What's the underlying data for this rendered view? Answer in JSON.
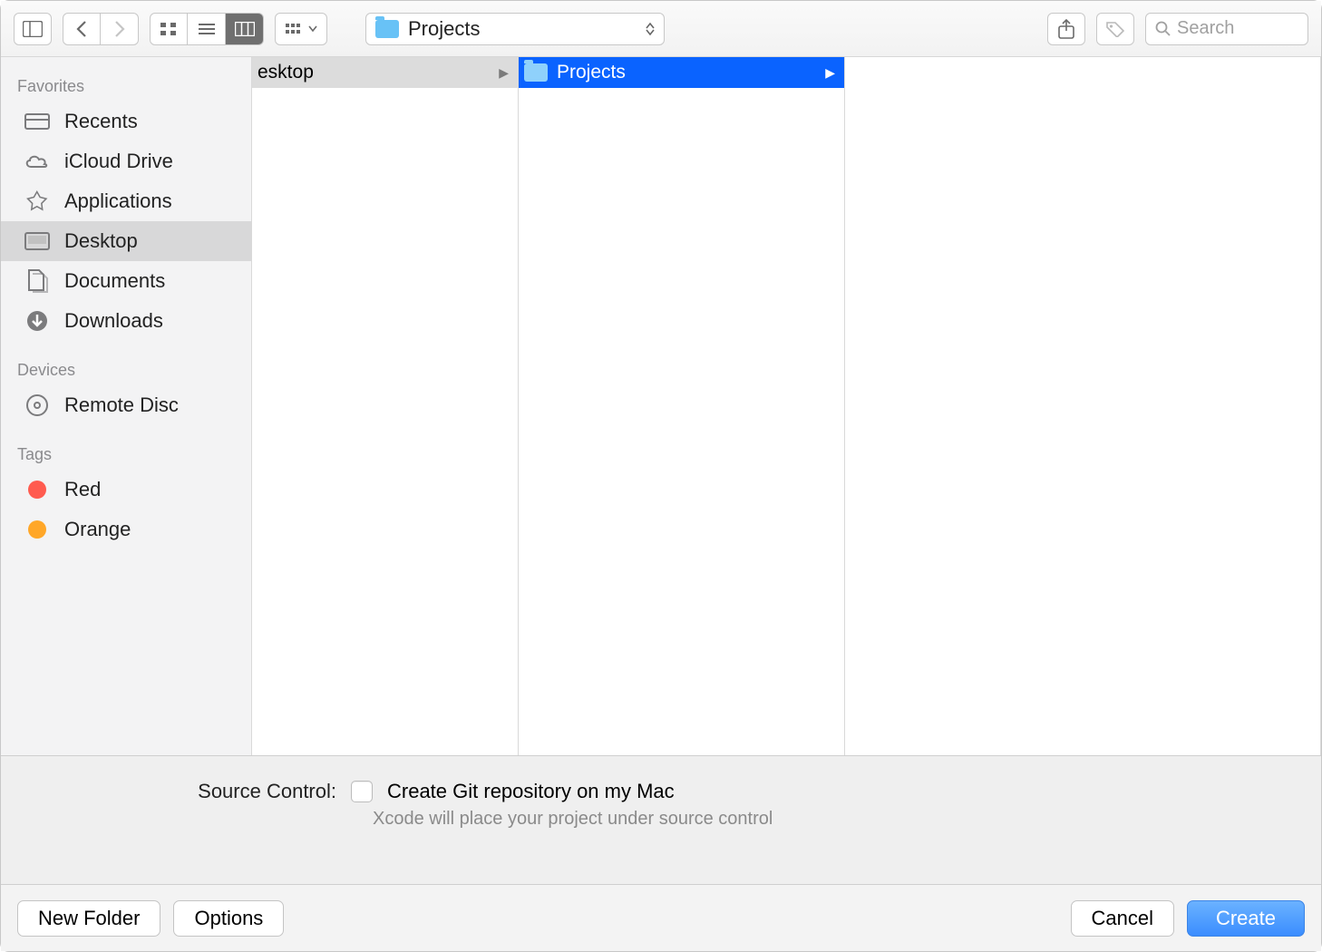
{
  "toolbar": {
    "path_label": "Projects",
    "search_placeholder": "Search"
  },
  "sidebar": {
    "sections": [
      {
        "header": "Favorites",
        "items": [
          {
            "label": "Recents",
            "icon": "recents",
            "selected": false
          },
          {
            "label": "iCloud Drive",
            "icon": "icloud",
            "selected": false
          },
          {
            "label": "Applications",
            "icon": "applications",
            "selected": false
          },
          {
            "label": "Desktop",
            "icon": "desktop",
            "selected": true
          },
          {
            "label": "Documents",
            "icon": "documents",
            "selected": false
          },
          {
            "label": "Downloads",
            "icon": "downloads",
            "selected": false
          }
        ]
      },
      {
        "header": "Devices",
        "items": [
          {
            "label": "Remote Disc",
            "icon": "disc",
            "selected": false
          }
        ]
      },
      {
        "header": "Tags",
        "items": [
          {
            "label": "Red",
            "icon": "tag",
            "color": "#ff5b4f",
            "selected": false
          },
          {
            "label": "Orange",
            "icon": "tag",
            "color": "#ffa728",
            "selected": false
          }
        ]
      }
    ]
  },
  "columns": {
    "col1": {
      "label": "esktop"
    },
    "col2": {
      "label": "Projects"
    }
  },
  "source_control": {
    "label": "Source Control:",
    "checkbox_label": "Create Git repository on my Mac",
    "description": "Xcode will place your project under source control"
  },
  "buttons": {
    "new_folder": "New Folder",
    "options": "Options",
    "cancel": "Cancel",
    "create": "Create"
  }
}
